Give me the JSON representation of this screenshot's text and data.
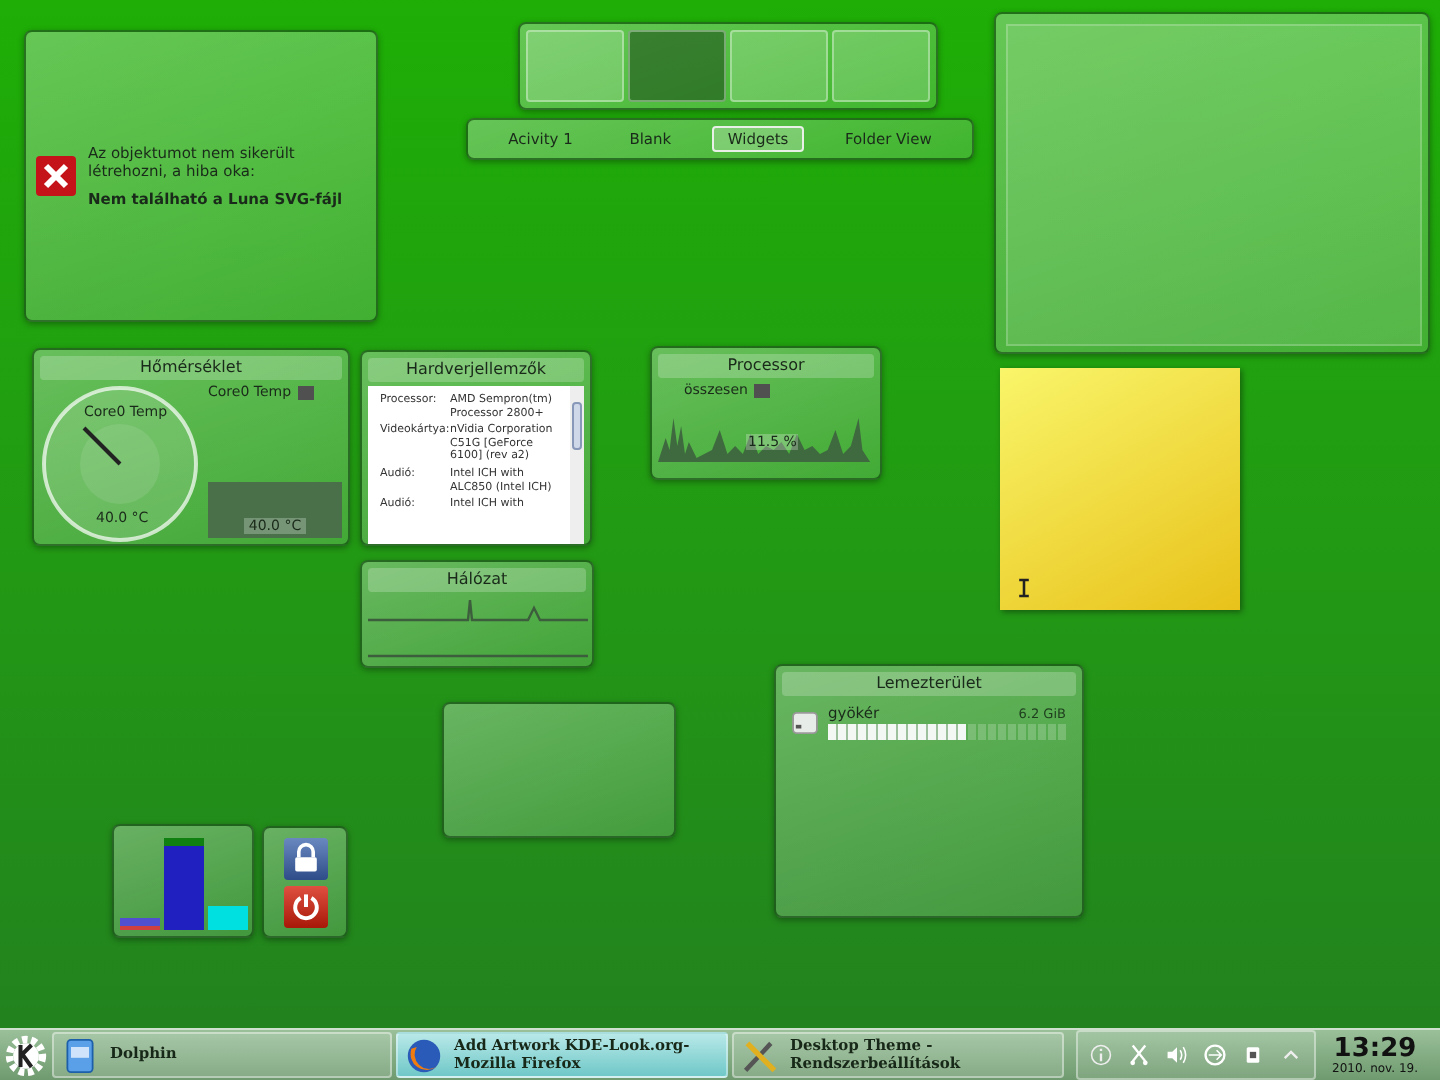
{
  "error_widget": {
    "message": "Az objektumot nem sikerült létrehozni, a hiba oka:",
    "detail": "Nem található a Luna SVG-fájl"
  },
  "pager": {
    "desktops": [
      {
        "selected": false
      },
      {
        "selected": true
      },
      {
        "selected": false
      },
      {
        "selected": false
      }
    ]
  },
  "activities": [
    {
      "label": "Acivity 1",
      "selected": false
    },
    {
      "label": "Blank",
      "selected": false
    },
    {
      "label": "Widgets",
      "selected": true
    },
    {
      "label": "Folder View",
      "selected": false
    }
  ],
  "temperature": {
    "title": "Hőmérséklet",
    "sensor_label": "Core0 Temp",
    "gauge_label": "Core0 Temp",
    "gauge_reading": "40.0 °C",
    "graph_reading": "40.0 °C"
  },
  "hardware": {
    "title": "Hardverjellemzők",
    "rows": [
      {
        "label": "Processor:",
        "value": "AMD Sempron(tm) Processor 2800+"
      },
      {
        "label": "Videokártya:",
        "value": "nVidia Corporation C51G [GeForce 6100] (rev a2)"
      },
      {
        "label": "Audió:",
        "value": "Intel ICH with ALC850 (Intel ICH)"
      },
      {
        "label": "Audió:",
        "value": "Intel ICH with"
      }
    ]
  },
  "network": {
    "title": "Hálózat"
  },
  "processor": {
    "title": "Processor",
    "legend_label": "összesen",
    "reading": "11.5 %"
  },
  "disk": {
    "title": "Lemezterület",
    "items": [
      {
        "name": "gyökér",
        "size": "6.2 GiB",
        "level": 0.58
      }
    ]
  },
  "taskbar": {
    "tasks": [
      {
        "label": "Dolphin",
        "kind": "folder",
        "selected": false
      },
      {
        "label": "Add  Artwork KDE-Look.org-Mozilla Firefox",
        "kind": "browser",
        "selected": true
      },
      {
        "label": "Desktop Theme - Rendszerbeállítások",
        "kind": "tools",
        "selected": false
      }
    ],
    "clock": {
      "time": "13:29",
      "date": "2010. nov. 19."
    }
  }
}
